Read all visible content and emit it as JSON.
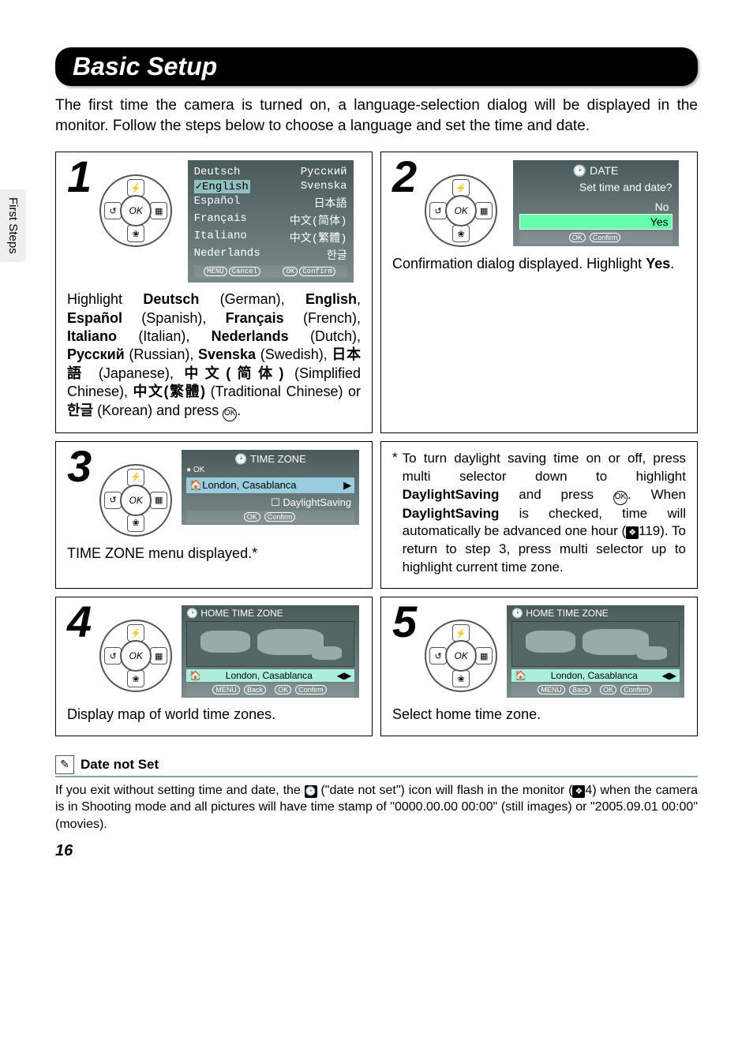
{
  "sideTab": "First Steps",
  "title": "Basic Setup",
  "intro": "The first time the camera is turned on, a language-selection dialog will be displayed in the monitor. Follow the steps below to choose a language and set the time and date.",
  "step1": {
    "num": "1",
    "languages": {
      "left": [
        "Deutsch",
        "English",
        "Español",
        "Français",
        "Italiano",
        "Nederlands"
      ],
      "right": [
        "Русский",
        "Svenska",
        "日本語",
        "中文(简体)",
        "中文(繁體)",
        "한글"
      ]
    },
    "footer": {
      "cancel": "Cancel",
      "confirm": "Confirm",
      "menuBtn": "MENU",
      "okBtn": "OK"
    },
    "caption_parts": {
      "p1": "Highlight ",
      "b1": "Deutsch",
      "p2": " (German), ",
      "b2": "English",
      "p3": ", ",
      "b3": "Español",
      "p4": " (Spanish), ",
      "b4": "Français",
      "p5": " (French), ",
      "b5": "Italiano",
      "p6": " (Italian), ",
      "b6": "Nederlands",
      "p7": " (Dutch), ",
      "b7": "Русский",
      "p8": " (Russian), ",
      "b8": "Svenska",
      "p9": " (Swedish), ",
      "b9": "日本語",
      "p10": " (Japanese), ",
      "b10": "中文(简体)",
      "p11": " (Simplified Chinese), ",
      "b11": "中文(繁體)",
      "p12": " (Traditional Chinese) or ",
      "b12": "한글",
      "p13": " (Korean) and press ",
      "p14": "."
    }
  },
  "step2": {
    "num": "2",
    "screen": {
      "title": "DATE",
      "question": "Set time and date?",
      "no": "No",
      "yes": "Yes",
      "confirm": "Confirm",
      "okBtn": "OK"
    },
    "caption_a": "Confirmation dialog displayed. Highlight ",
    "caption_b": "Yes",
    "caption_c": "."
  },
  "step3": {
    "num": "3",
    "screen": {
      "title": "TIME ZONE",
      "location": "London, Casablanca",
      "daylight": "DaylightSaving",
      "confirm": "Confirm",
      "okDot": "OK",
      "okBtn": "OK"
    },
    "caption": "TIME ZONE menu displayed.*"
  },
  "asteriskNote": {
    "star": "*",
    "p1": "To turn daylight saving time on or off, press multi selector down to highlight ",
    "b1": "DaylightSaving",
    "p2": " and press ",
    "p3": ". When ",
    "b2": "DaylightSaving",
    "p4": " is checked, time will automatically be advanced one hour (",
    "ref": "119",
    "p5": "). To return to step 3, press multi selector up to highlight current time zone."
  },
  "step4": {
    "num": "4",
    "screen": {
      "title": "HOME TIME ZONE",
      "location": "London, Casablanca",
      "back": "Back",
      "confirm": "Confirm",
      "menuBtn": "MENU",
      "okBtn": "OK"
    },
    "caption": "Display map of world time zones."
  },
  "step5": {
    "num": "5",
    "screen": {
      "title": "HOME TIME ZONE",
      "location": "London, Casablanca",
      "back": "Back",
      "confirm": "Confirm",
      "menuBtn": "MENU",
      "okBtn": "OK"
    },
    "caption": "Select home time zone."
  },
  "note": {
    "title": "Date not Set",
    "body_a": "If you exit without setting time and date, the ",
    "body_b": " (\"date not set\") icon will flash in the monitor (",
    "ref": "4",
    "body_c": ") when the camera is in Shooting mode and all pictures will have time stamp of \"0000.00.00 00:00\" (still images) or \"2005.09.01 00:00\" (movies)."
  },
  "pageNumber": "16",
  "okLabel": "OK"
}
